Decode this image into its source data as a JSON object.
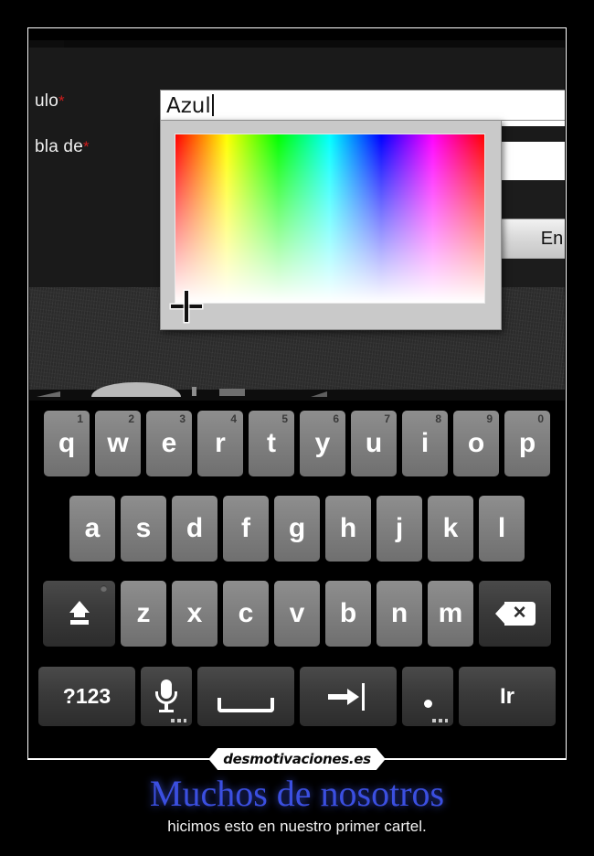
{
  "app": {
    "form": {
      "labels": [
        {
          "text": "ulo",
          "required_mark": "*"
        },
        {
          "text": "bla de",
          "required_mark": "*"
        }
      ],
      "submit_button": "En"
    },
    "color_picker": {
      "input_value": "Azul",
      "gradient_type": "hue-saturation",
      "hue_stops": [
        "#ff0000",
        "#ffff00",
        "#00ff00",
        "#00ffff",
        "#0000ff",
        "#ff00ff",
        "#ff0000"
      ],
      "crosshair_label": "crosshair"
    }
  },
  "keyboard": {
    "row1": [
      {
        "label": "q",
        "num": "1"
      },
      {
        "label": "w",
        "num": "2"
      },
      {
        "label": "e",
        "num": "3"
      },
      {
        "label": "r",
        "num": "4"
      },
      {
        "label": "t",
        "num": "5"
      },
      {
        "label": "y",
        "num": "6"
      },
      {
        "label": "u",
        "num": "7"
      },
      {
        "label": "i",
        "num": "8"
      },
      {
        "label": "o",
        "num": "9"
      },
      {
        "label": "p",
        "num": "0"
      }
    ],
    "row2": [
      {
        "label": "a"
      },
      {
        "label": "s"
      },
      {
        "label": "d"
      },
      {
        "label": "f"
      },
      {
        "label": "g"
      },
      {
        "label": "h"
      },
      {
        "label": "j"
      },
      {
        "label": "k"
      },
      {
        "label": "l"
      }
    ],
    "row3": [
      {
        "label": "z"
      },
      {
        "label": "x"
      },
      {
        "label": "c"
      },
      {
        "label": "v"
      },
      {
        "label": "b"
      },
      {
        "label": "n"
      },
      {
        "label": "m"
      }
    ],
    "shift_key": "shift",
    "backspace_key": "backspace",
    "row4": {
      "symbols": "?123",
      "mic": "microphone",
      "space": "space",
      "tab": "tab",
      "period": ".",
      "go": "Ir"
    }
  },
  "poster": {
    "watermark": "desmotivaciones.es",
    "title": "Muchos de nosotros",
    "subtitle": "hicimos esto en nuestro primer cartel."
  },
  "colors": {
    "title_blue": "#3b4fe0",
    "required_red": "#d01c1c",
    "frame_white": "#ffffff"
  }
}
